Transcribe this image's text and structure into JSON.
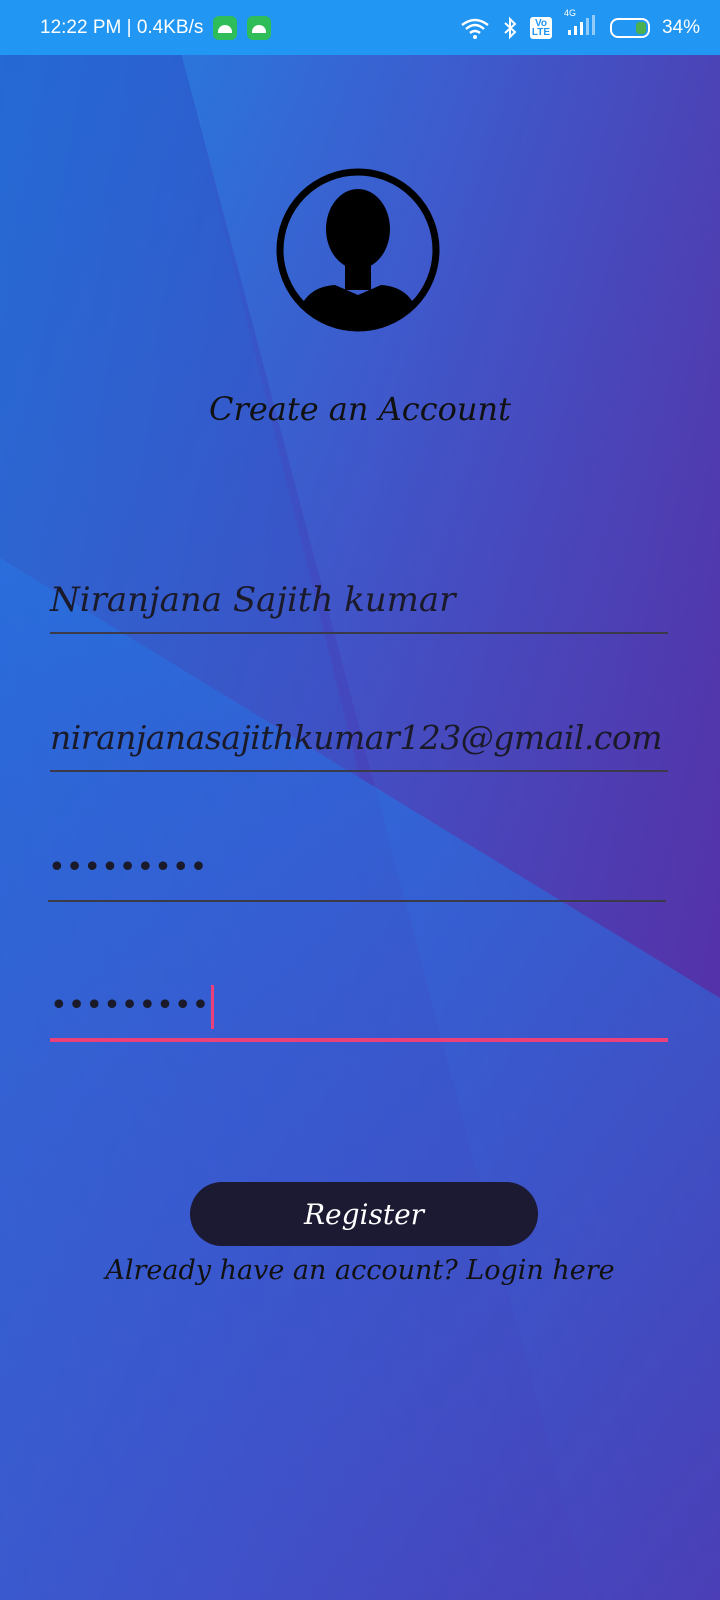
{
  "status_bar": {
    "time_speed": "12:22 PM | 0.4KB/s",
    "network": "4G",
    "volte": "Vo LTE",
    "battery": "34%"
  },
  "icons": {
    "avatar": "person-avatar-icon",
    "wifi": "wifi-icon",
    "bluetooth": "bluetooth-icon",
    "signal": "signal-icon",
    "battery": "battery-charging-icon"
  },
  "form": {
    "title": "Create an Account",
    "name_value": "Niranjana Sajith kumar",
    "email_value": "niranjanasajithkumar123@gmail.com",
    "password_value": "•••••••••",
    "confirm_password_value": "•••••••••"
  },
  "actions": {
    "register_label": "Register",
    "login_link": "Already have an account? Login here"
  },
  "colors": {
    "status_bar": "#2196f3",
    "accent": "#ec407a",
    "button": "#1c1933"
  }
}
